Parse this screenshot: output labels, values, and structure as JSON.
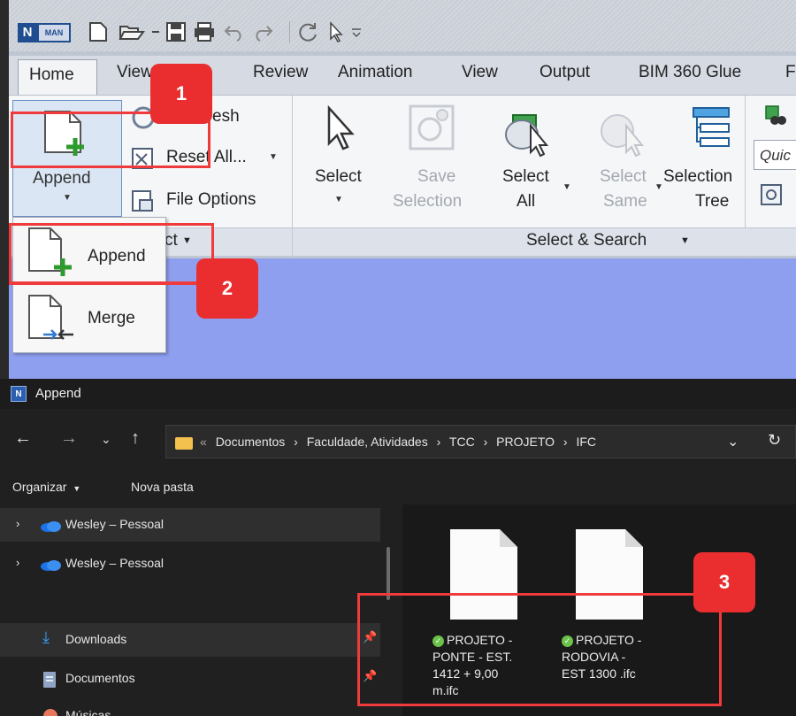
{
  "quick_access": {
    "logo_letter": "N",
    "logo_text": "MAN"
  },
  "ribbon": {
    "tabs": [
      "Home",
      "View",
      "Review",
      "Animation",
      "View",
      "Output",
      "BIM 360 Glue",
      "F"
    ],
    "project_panel": {
      "refresh_label": "esh",
      "reset_all_label": "Reset All...",
      "file_options_label": "File Options",
      "append_label": "Append",
      "panel_title": "ct"
    },
    "select_panel": {
      "select_label": "Select",
      "save_selection_label_1": "Save",
      "save_selection_label_2": "Selection",
      "select_all_label_1": "Select",
      "select_all_label_2": "All",
      "select_same_label_1": "Select",
      "select_same_label_2": "Same",
      "selection_tree_label_1": "Selection",
      "selection_tree_label_2": "Tree",
      "quick_find_placeholder": "Quic",
      "panel_title": "Select & Search"
    }
  },
  "append_dropdown": {
    "items": [
      {
        "label": "Append"
      },
      {
        "label": "Merge"
      }
    ]
  },
  "dialog": {
    "title": "Append",
    "breadcrumb": [
      "«",
      "Documentos",
      "›",
      "Faculdade, Atividades",
      "›",
      "TCC",
      "›",
      "PROJETO",
      "›",
      "IFC"
    ],
    "organize_label": "Organizar",
    "new_folder_label": "Nova pasta",
    "nav_items": [
      {
        "label": "Wesley – Pessoal"
      },
      {
        "label": "Wesley – Pessoal"
      },
      {
        "label": "Downloads"
      },
      {
        "label": "Documentos"
      },
      {
        "label": "Músicas"
      }
    ],
    "files": [
      {
        "name": "PROJETO -\nPONTE - EST.\n1412 + 9,00\nm.ifc"
      },
      {
        "name": "PROJETO -\nRODOVIA -\nEST 1300 .ifc"
      }
    ]
  },
  "annotations": {
    "badge_1": "1",
    "badge_2": "2",
    "badge_3": "3",
    "color": "#ef3b3b"
  }
}
